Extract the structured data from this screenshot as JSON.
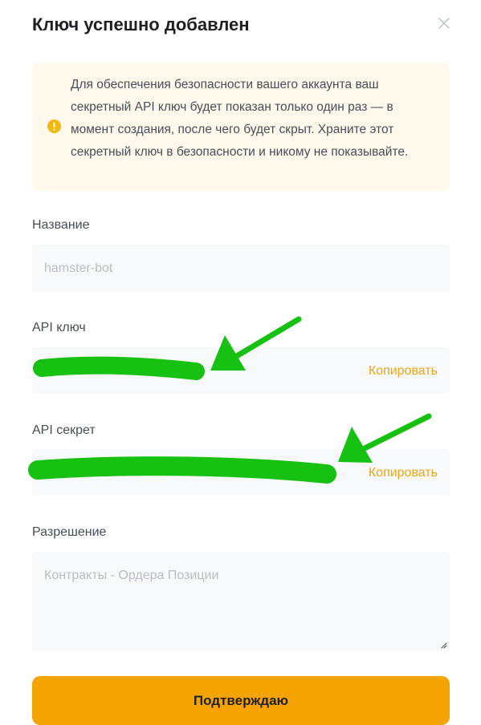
{
  "dialog": {
    "title": "Ключ успешно добавлен",
    "close_icon": "close-icon",
    "notice": {
      "icon": "warning-circle-icon",
      "text": "Для обеспечения безопасности вашего аккаунта ваш секретный API ключ будет показан только один раз — в момент создания, после чего будет скрыт. Храните этот секретный ключ в безопасности и никому не показывайте."
    },
    "name_field": {
      "label": "Название",
      "value": "hamster-bot"
    },
    "api_key_field": {
      "label": "API ключ",
      "copy_label": "Копировать"
    },
    "api_secret_field": {
      "label": "API секрет",
      "copy_label": "Копировать"
    },
    "permission_field": {
      "label": "Разрешение",
      "value": "Контракты - Ордера Позиции"
    },
    "confirm_label": "Подтверждаю",
    "colors": {
      "accent": "#f5a300",
      "link": "#eaa514",
      "notice_bg": "#fef9ec",
      "redaction": "#17c112"
    }
  }
}
